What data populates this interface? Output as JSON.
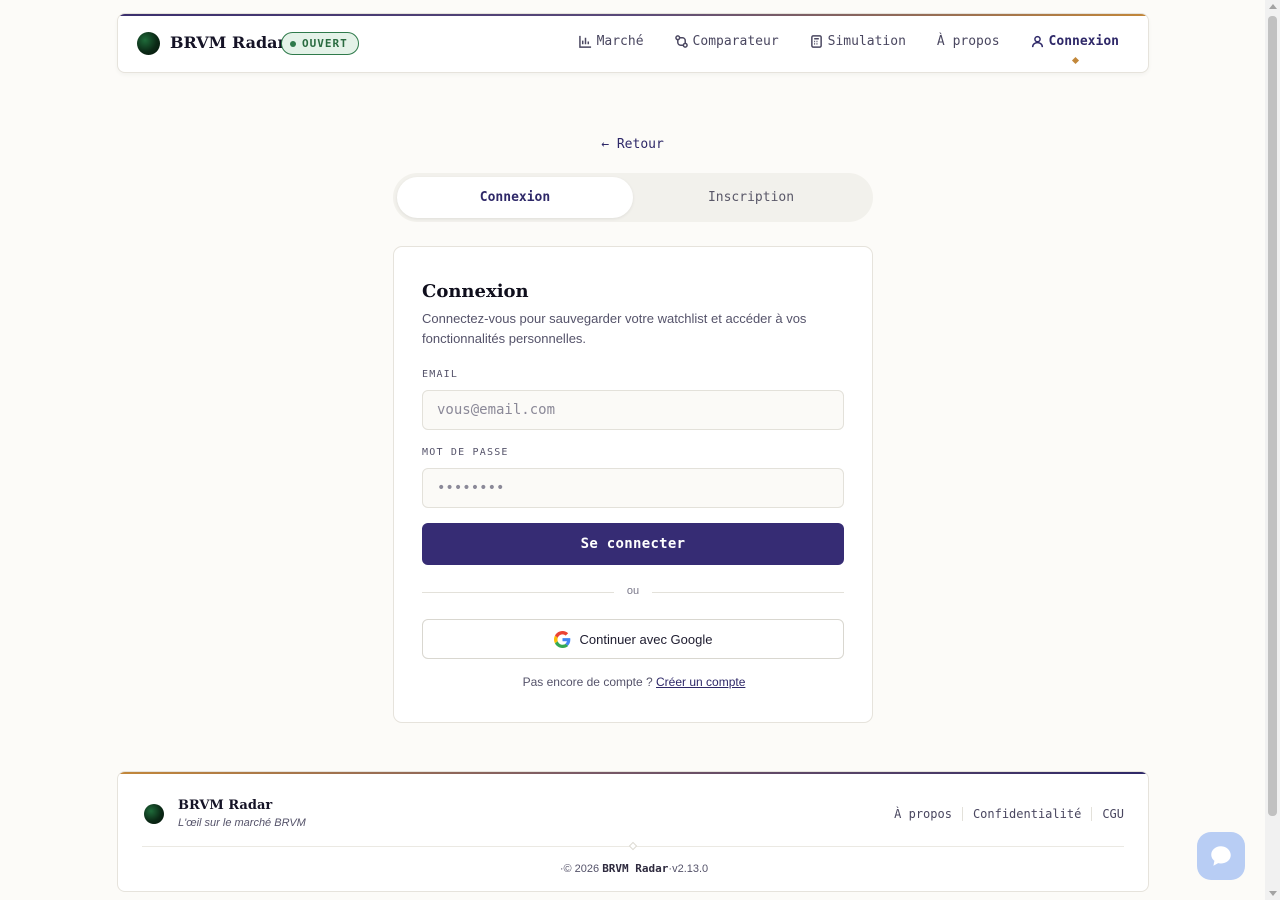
{
  "header": {
    "brand": "BRVM Radar",
    "status_badge": "OUVERT",
    "nav": [
      {
        "label": "Marché",
        "icon": "bar-chart-icon",
        "active": false
      },
      {
        "label": "Comparateur",
        "icon": "compare-arrows-icon",
        "active": false
      },
      {
        "label": "Simulation",
        "icon": "calculator-icon",
        "active": false
      },
      {
        "label": "À propos",
        "icon": "",
        "active": false
      },
      {
        "label": "Connexion",
        "icon": "user-icon",
        "active": true
      }
    ]
  },
  "back_link": "← Retour",
  "tabs": [
    {
      "label": "Connexion",
      "active": true
    },
    {
      "label": "Inscription",
      "active": false
    }
  ],
  "form": {
    "title": "Connexion",
    "subtitle": "Connectez-vous pour sauvegarder votre watchlist et accéder à vos fonctionnalités personnelles.",
    "email_label": "EMAIL",
    "email_placeholder": "vous@email.com",
    "email_value": "",
    "password_label": "MOT DE PASSE",
    "password_placeholder": "••••••••",
    "submit_label": "Se connecter",
    "divider_text": "ou",
    "google_label": "Continuer avec Google",
    "no_account_text": "Pas encore de compte ?",
    "create_account_link": "Créer un compte"
  },
  "footer": {
    "brand": "BRVM Radar",
    "tagline": "L'œil sur le marché BRVM",
    "links": [
      "À propos",
      "Confidentialité",
      "CGU"
    ],
    "copyright_prefix": "·© 2026",
    "copyright_brand": "BRVM Radar",
    "version": "·v2.13.0"
  },
  "colors": {
    "primary": "#362c74",
    "accent": "#c2873a",
    "status_green": "#2f7a4b",
    "background": "#fcfbf8"
  }
}
